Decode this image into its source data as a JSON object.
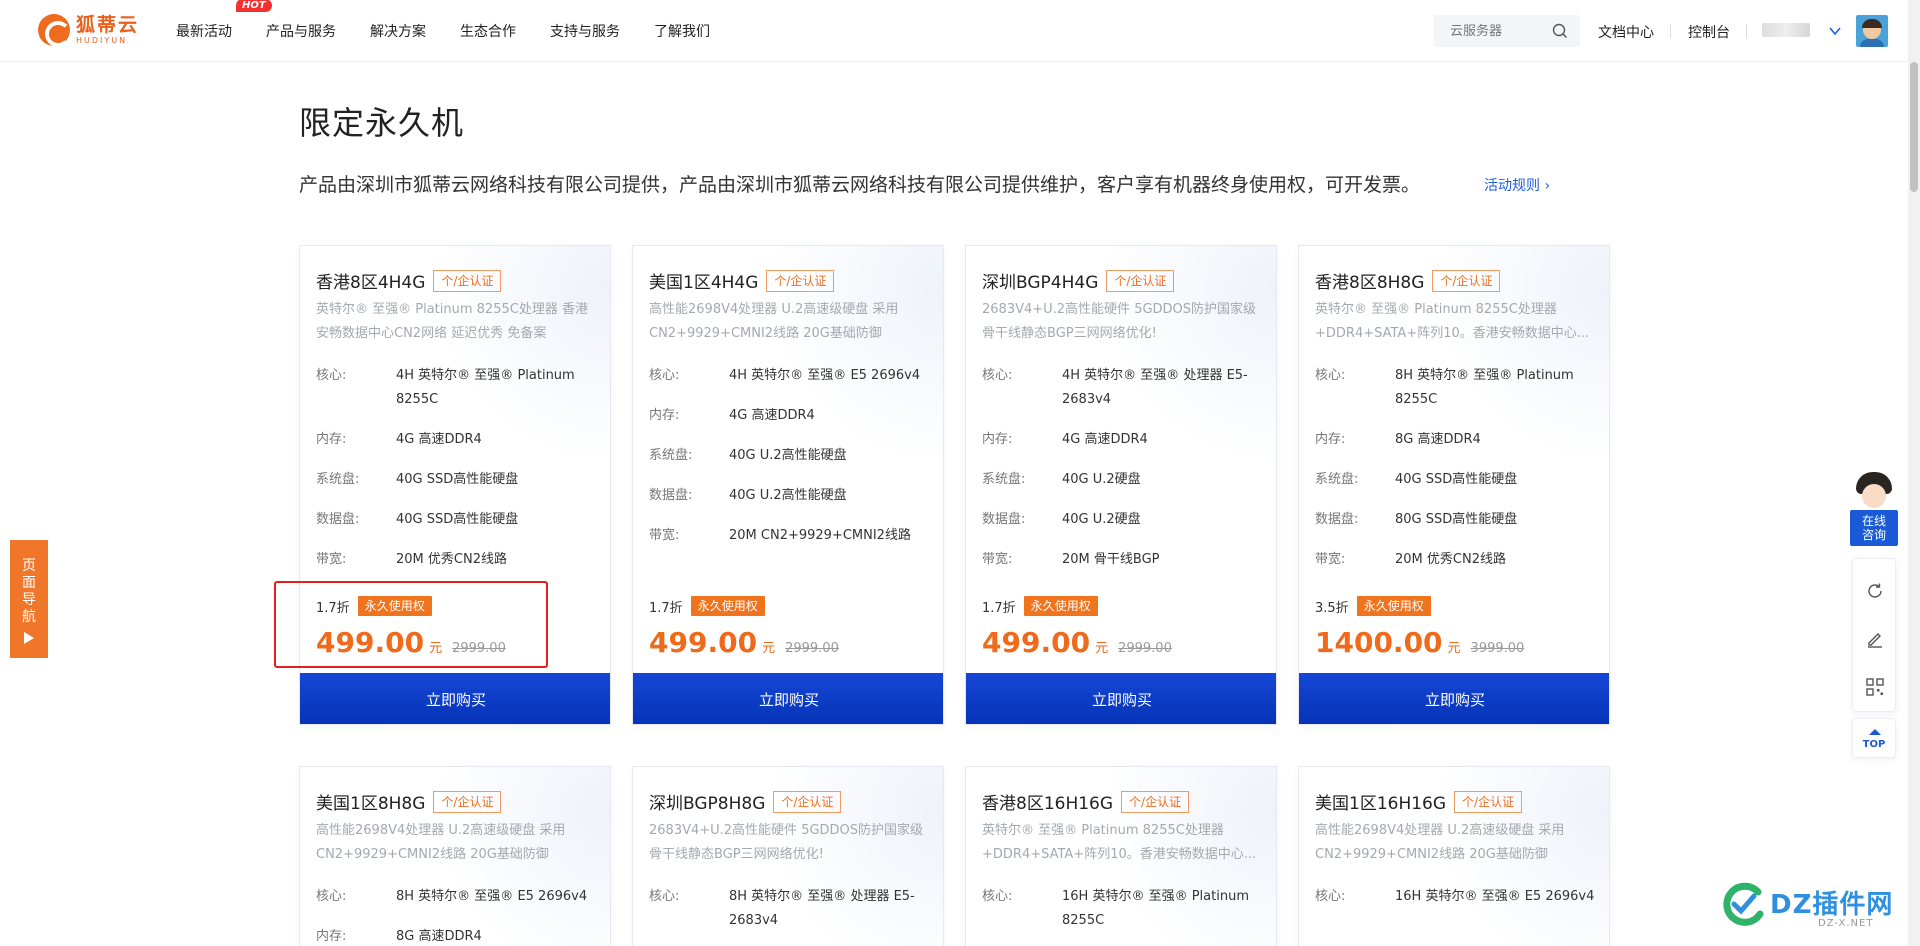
{
  "header": {
    "logo_cn": "狐蒂云",
    "logo_en": "HUDIYUN",
    "nav": [
      {
        "label": "最新活动"
      },
      {
        "label": "产品与服务"
      },
      {
        "label": "解决方案"
      },
      {
        "label": "生态合作"
      },
      {
        "label": "支持与服务"
      },
      {
        "label": "了解我们"
      }
    ],
    "hot_badge": "HOT",
    "search_placeholder": "云服务器",
    "docs_label": "文档中心",
    "console_label": "控制台"
  },
  "page": {
    "title": "限定永久机",
    "description": "产品由深圳市狐蒂云网络科技有限公司提供，产品由深圳市狐蒂云网络科技有限公司提供维护，客户享有机器终身使用权，可开发票。",
    "rules_link": "活动规则 ›"
  },
  "cards_row1": [
    {
      "name": "香港8区4H4G",
      "tag": "个/企认证",
      "desc": "英特尔® 至强® Platinum 8255C处理器 香港安畅数据中心CN2网络 延迟优秀 免备案",
      "specs": [
        {
          "label": "核心:",
          "value": "4H 英特尔® 至强® Platinum 8255C"
        },
        {
          "label": "内存:",
          "value": "4G 高速DDR4"
        },
        {
          "label": "系统盘:",
          "value": "40G SSD高性能硬盘"
        },
        {
          "label": "数据盘:",
          "value": "40G SSD高性能硬盘"
        },
        {
          "label": "带宽:",
          "value": "20M 优秀CN2线路"
        }
      ],
      "discount": "1.7折",
      "forever": "永久使用权",
      "price": "499.00",
      "unit": "元",
      "old_price": "2999.00",
      "buy": "立即购买"
    },
    {
      "name": "美国1区4H4G",
      "tag": "个/企认证",
      "desc": "高性能2698V4处理器 U.2高速级硬盘 采用CN2+9929+CMNI2线路 20G基础防御",
      "specs": [
        {
          "label": "核心:",
          "value": "4H 英特尔® 至强® E5 2696v4"
        },
        {
          "label": "内存:",
          "value": "4G 高速DDR4"
        },
        {
          "label": "系统盘:",
          "value": "40G U.2高性能硬盘"
        },
        {
          "label": "数据盘:",
          "value": "40G U.2高性能硬盘"
        },
        {
          "label": "带宽:",
          "value": "20M CN2+9929+CMNI2线路"
        }
      ],
      "discount": "1.7折",
      "forever": "永久使用权",
      "price": "499.00",
      "unit": "元",
      "old_price": "2999.00",
      "buy": "立即购买"
    },
    {
      "name": "深圳BGP4H4G",
      "tag": "个/企认证",
      "desc": "2683V4+U.2高性能硬件 5GDDOS防护国家级骨干线静态BGP三网网络优化!",
      "specs": [
        {
          "label": "核心:",
          "value": "4H 英特尔® 至强® 处理器 E5-2683v4"
        },
        {
          "label": "内存:",
          "value": "4G 高速DDR4"
        },
        {
          "label": "系统盘:",
          "value": "40G U.2硬盘"
        },
        {
          "label": "数据盘:",
          "value": "40G U.2硬盘"
        },
        {
          "label": "带宽:",
          "value": "20M 骨干线BGP"
        }
      ],
      "discount": "1.7折",
      "forever": "永久使用权",
      "price": "499.00",
      "unit": "元",
      "old_price": "2999.00",
      "buy": "立即购买"
    },
    {
      "name": "香港8区8H8G",
      "tag": "个/企认证",
      "desc": "英特尔® 至强® Platinum 8255C处理器 +DDR4+SATA+阵列10。香港安畅数据中心...",
      "specs": [
        {
          "label": "核心:",
          "value": "8H 英特尔® 至强® Platinum 8255C"
        },
        {
          "label": "内存:",
          "value": "8G 高速DDR4"
        },
        {
          "label": "系统盘:",
          "value": "40G SSD高性能硬盘"
        },
        {
          "label": "数据盘:",
          "value": "80G SSD高性能硬盘"
        },
        {
          "label": "带宽:",
          "value": "20M 优秀CN2线路"
        }
      ],
      "discount": "3.5折",
      "forever": "永久使用权",
      "price": "1400.00",
      "unit": "元",
      "old_price": "3999.00",
      "buy": "立即购买"
    }
  ],
  "cards_row2": [
    {
      "name": "美国1区8H8G",
      "tag": "个/企认证",
      "desc": "高性能2698V4处理器 U.2高速级硬盘 采用CN2+9929+CMNI2线路 20G基础防御",
      "specs": [
        {
          "label": "核心:",
          "value": "8H 英特尔® 至强® E5 2696v4"
        },
        {
          "label": "内存:",
          "value": "8G 高速DDR4"
        }
      ]
    },
    {
      "name": "深圳BGP8H8G",
      "tag": "个/企认证",
      "desc": "2683V4+U.2高性能硬件 5GDDOS防护国家级骨干线静态BGP三网网络优化!",
      "specs": [
        {
          "label": "核心:",
          "value": "8H 英特尔® 至强® 处理器 E5-2683v4"
        }
      ]
    },
    {
      "name": "香港8区16H16G",
      "tag": "个/企认证",
      "desc": "英特尔® 至强® Platinum 8255C处理器 +DDR4+SATA+阵列10。香港安畅数据中心...",
      "specs": [
        {
          "label": "核心:",
          "value": "16H 英特尔® 至强® Platinum 8255C"
        }
      ]
    },
    {
      "name": "美国1区16H16G",
      "tag": "个/企认证",
      "desc": "高性能2698V4处理器 U.2高速级硬盘 采用CN2+9929+CMNI2线路 20G基础防御",
      "specs": [
        {
          "label": "核心:",
          "value": "16H 英特尔® 至强® E5 2696v4"
        }
      ]
    }
  ],
  "left_nav": {
    "chars": [
      "页",
      "面",
      "导",
      "航"
    ]
  },
  "right_bar": {
    "consult_line1": "在线",
    "consult_line2": "咨询",
    "top_label": "TOP"
  },
  "watermark": {
    "text": "DZ插件网",
    "sub": "DZ-X.NET"
  },
  "colors": {
    "accent": "#f06a1b",
    "primary": "#0a3cc4",
    "link": "#1f5fe0"
  }
}
